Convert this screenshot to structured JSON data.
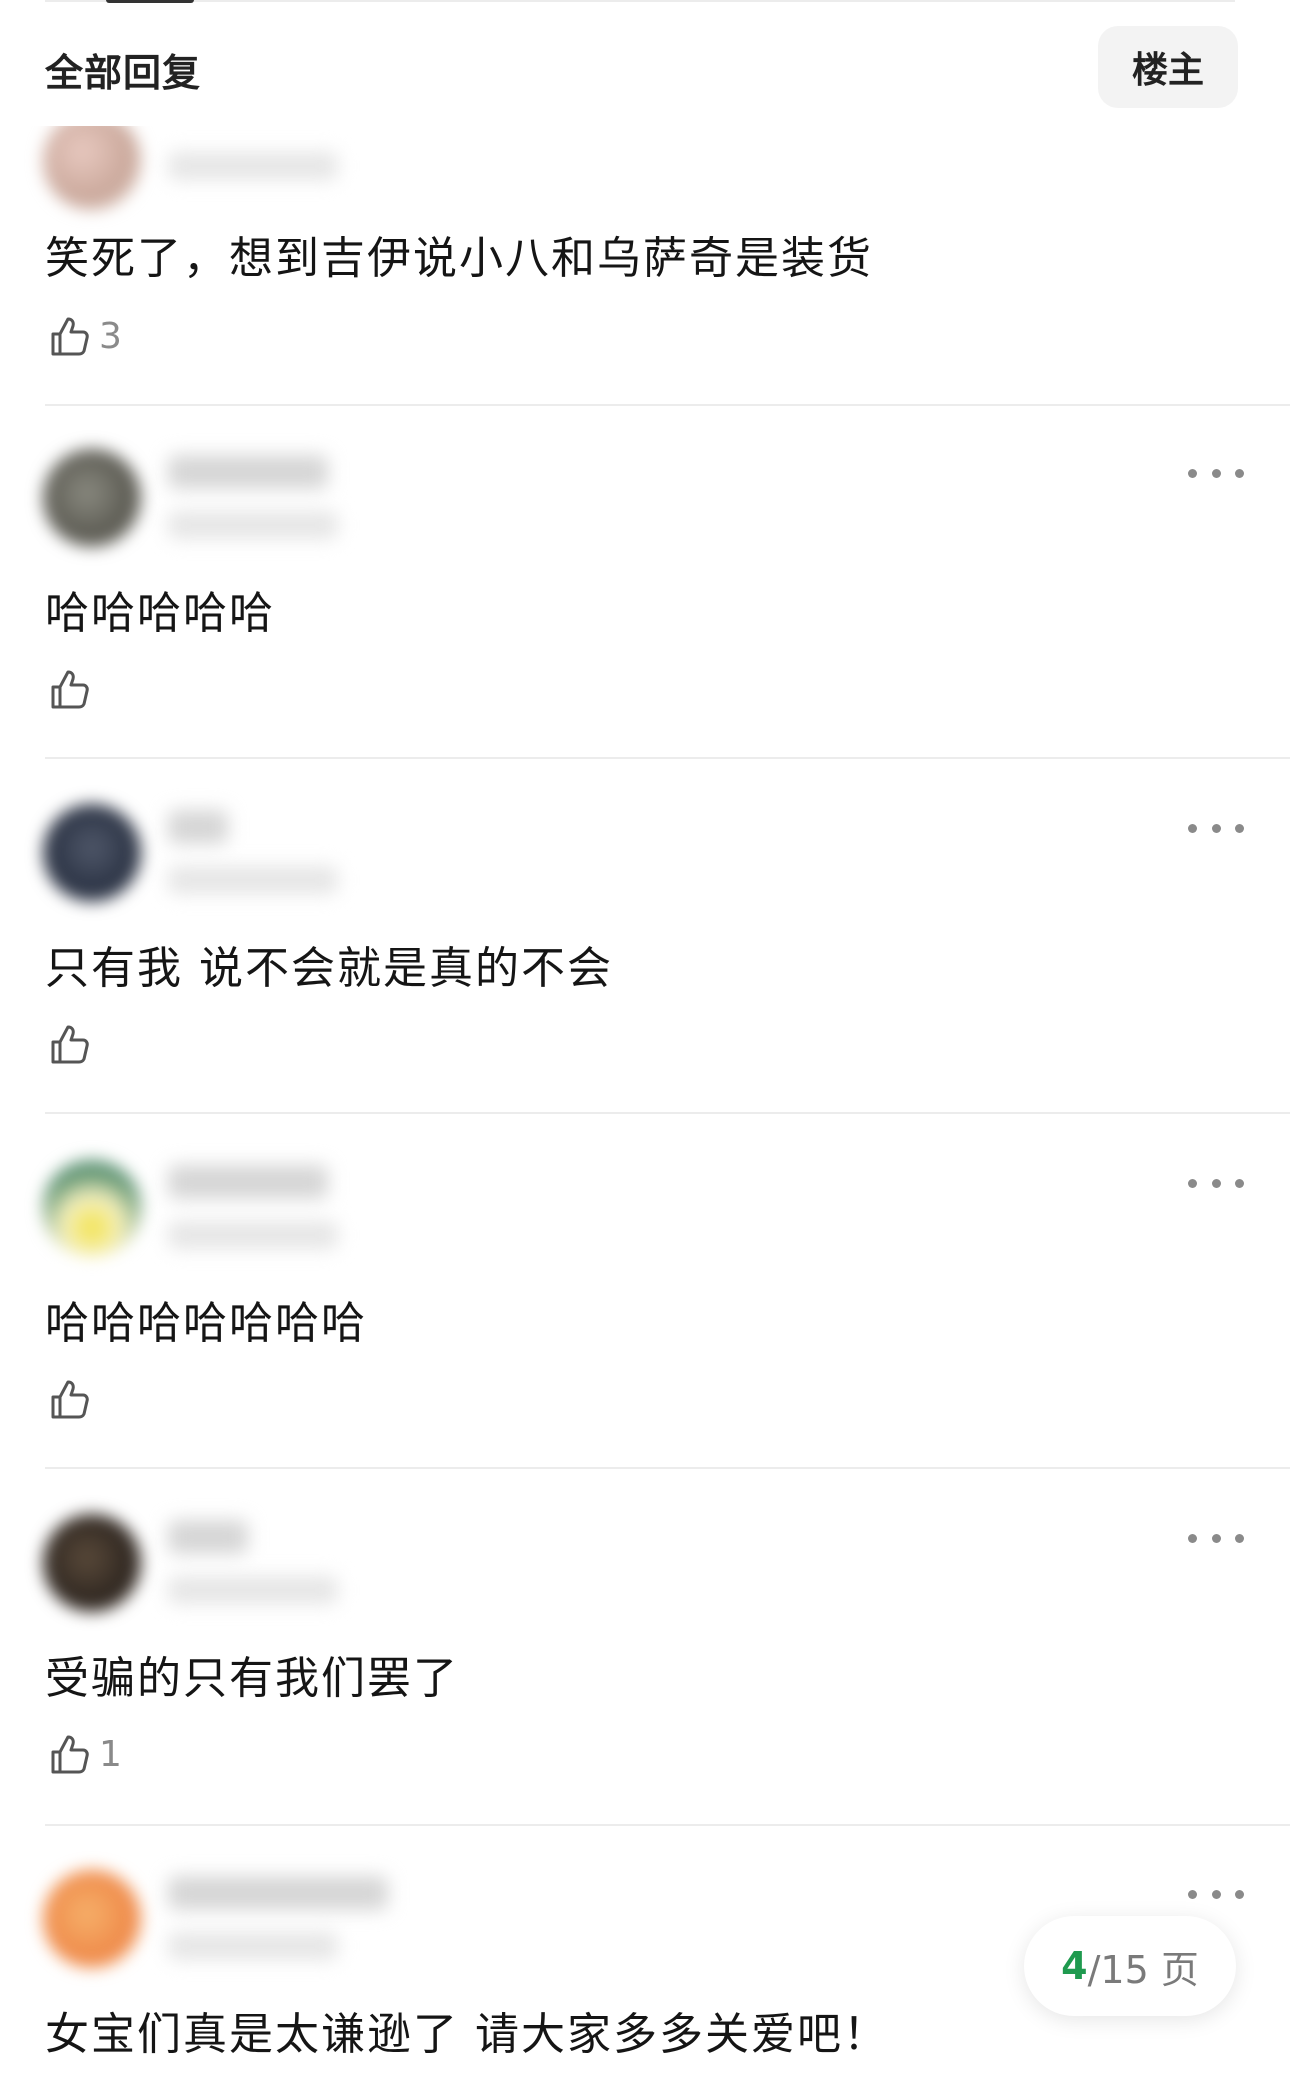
{
  "header": {
    "title": "全部回复",
    "op_button": "楼主"
  },
  "comments": [
    {
      "text": "笑死了，想到吉伊说小八和乌萨奇是装货",
      "likes": "3"
    },
    {
      "text": "哈哈哈哈哈",
      "likes": ""
    },
    {
      "text": "只有我 说不会就是真的不会",
      "likes": ""
    },
    {
      "text": "哈哈哈哈哈哈哈",
      "likes": ""
    },
    {
      "text": "受骗的只有我们罢了",
      "likes": "1"
    },
    {
      "text": "女宝们真是太谦逊了 请大家多多关爱吧！",
      "likes": ""
    }
  ],
  "pager": {
    "current": "4",
    "total": "/15 页"
  },
  "colors": {
    "accent": "#1f9a4f",
    "divider": "#ececec",
    "muted": "#8a8a8a"
  },
  "icons": {
    "like": "thumbs-up-icon",
    "more": "more-dots-icon"
  }
}
